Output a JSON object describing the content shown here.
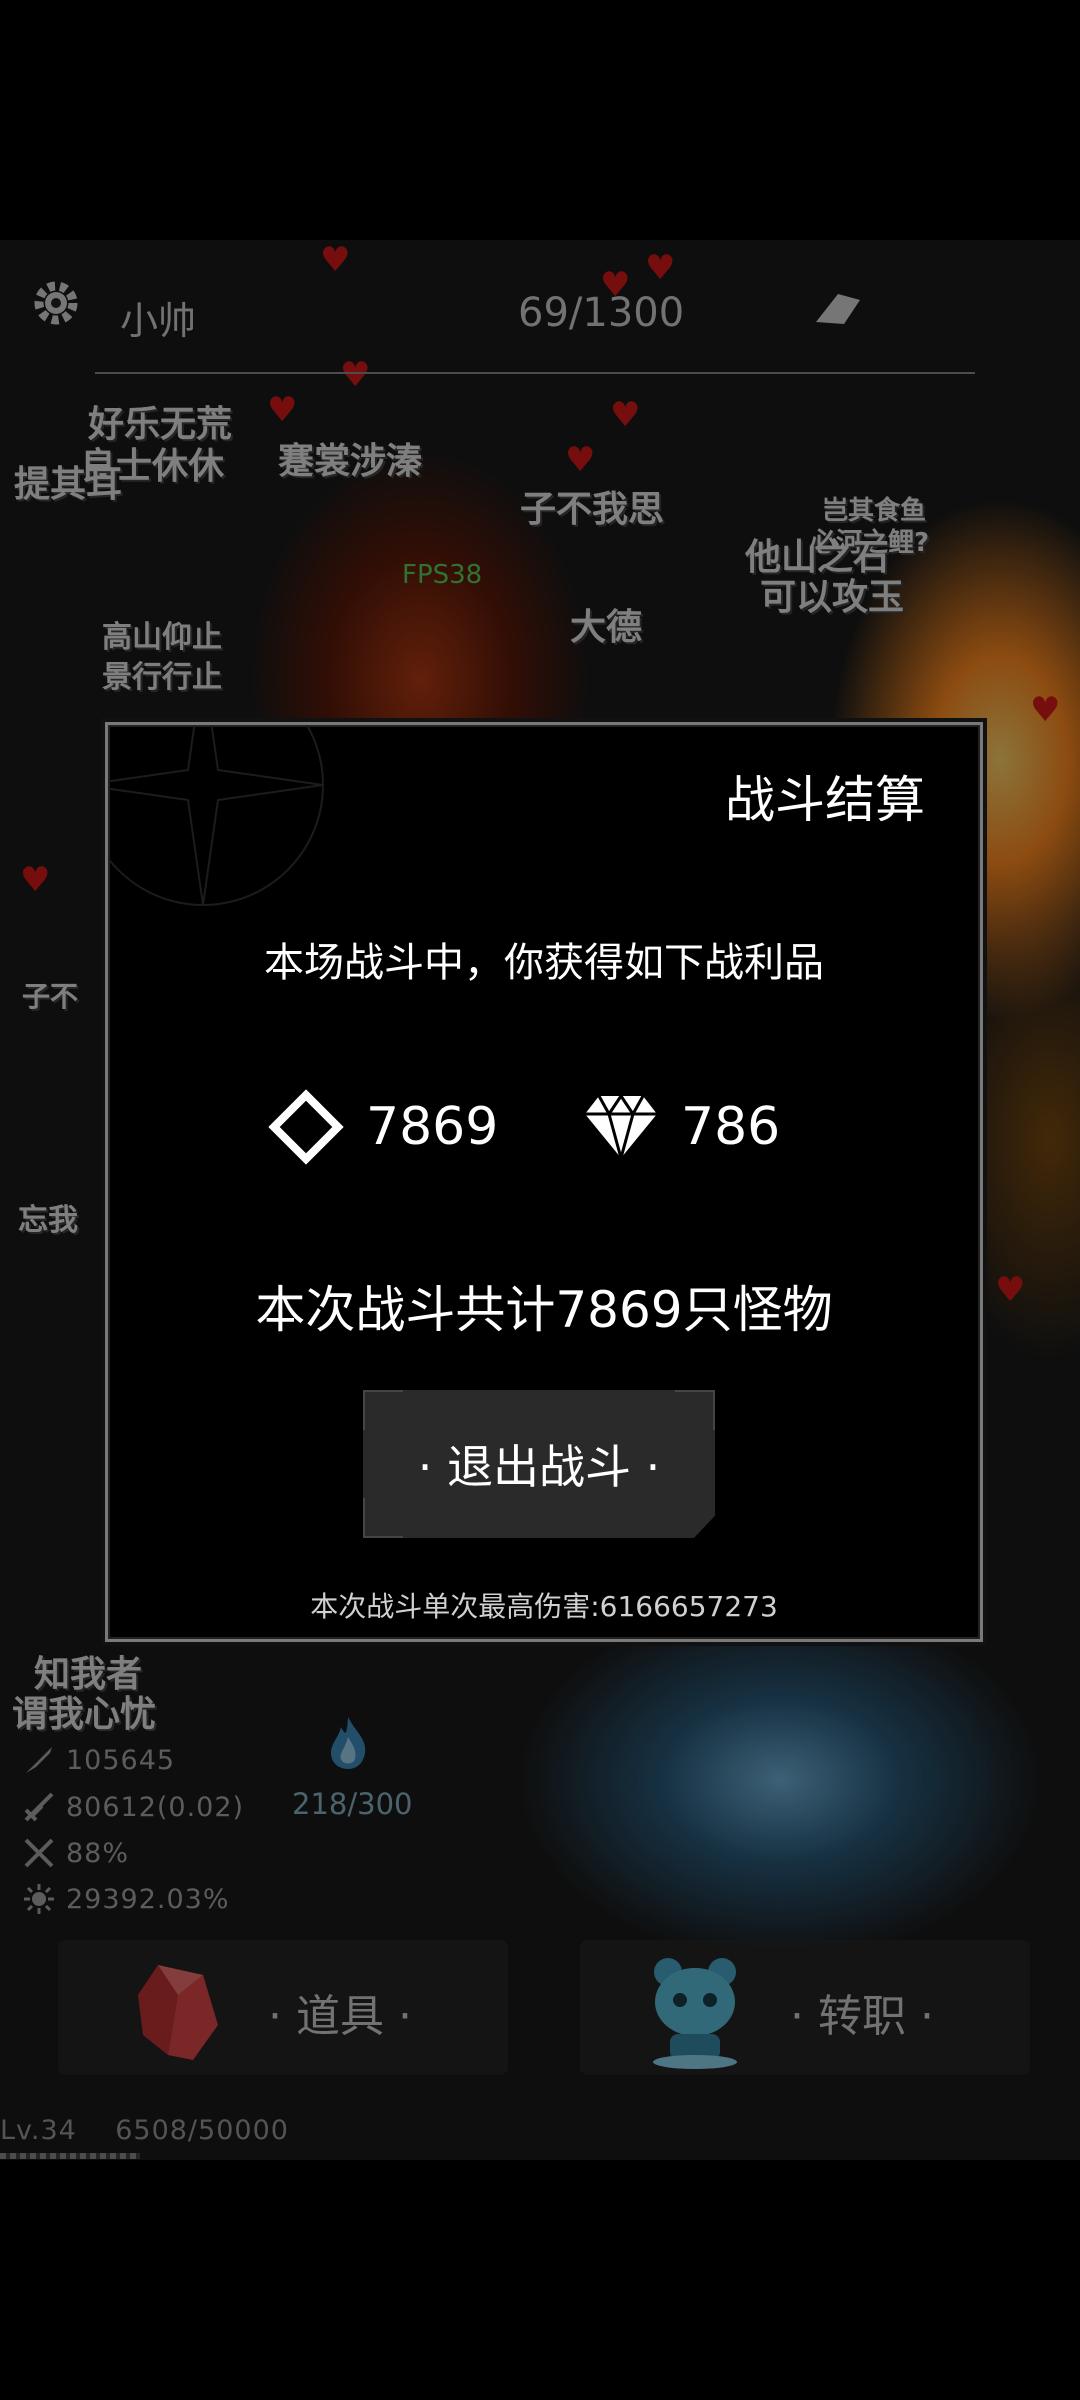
{
  "hud": {
    "player_name": "小帅",
    "wave": "69/1300",
    "fps": "FPS38"
  },
  "background_text": [
    "好乐无荒",
    "良士休休",
    "蹇裳涉溱",
    "子不我思",
    "岂其食鱼",
    "必河之鲤?",
    "他山之石",
    "可以攻玉",
    "高山仰止",
    "景行行止",
    "大德",
    "子不",
    "忘我",
    "知我者",
    "谓我心忧",
    "提其耳"
  ],
  "dialog": {
    "title": "战斗结算",
    "subtitle": "本场战斗中，你获得如下战利品",
    "rewards": [
      {
        "icon": "diamond-outline-icon",
        "value": "7869"
      },
      {
        "icon": "gem-icon",
        "value": "786"
      }
    ],
    "summary": "本次战斗共计7869只怪物",
    "exit_button": "· 退出战斗 ·",
    "max_damage": "本次战斗单次最高伤害:6166657273"
  },
  "stats": [
    {
      "icon": "attack-icon",
      "value": "105645"
    },
    {
      "icon": "crit-icon",
      "value": "80612(0.02)"
    },
    {
      "icon": "speed-icon",
      "value": "88%"
    },
    {
      "icon": "damage-icon",
      "value": "29392.03%"
    }
  ],
  "mana": "218/300",
  "buttons": {
    "items": "· 道具 ·",
    "job_change": "· 转职 ·"
  },
  "level": {
    "label": "Lv.34",
    "xp": "6508/50000",
    "progress": 0.13
  },
  "colors": {
    "heart": "#d91b1b",
    "fps": "#5ad05a",
    "mana": "#8ab4c8"
  }
}
